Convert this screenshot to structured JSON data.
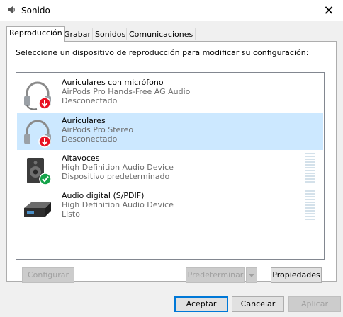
{
  "window": {
    "title": "Sonido",
    "close_glyph": "✕"
  },
  "tabs": [
    {
      "label": "Reproducción",
      "active": true
    },
    {
      "label": "Grabar",
      "active": false
    },
    {
      "label": "Sonidos",
      "active": false
    },
    {
      "label": "Comunicaciones",
      "active": false
    }
  ],
  "instruction": "Seleccione un dispositivo de reproducción para modificar su configuración:",
  "devices": [
    {
      "name": "Auriculares con micrófono",
      "model": "AirPods Pro Hands-Free AG Audio",
      "status": "Desconectado",
      "icon": "headset-disconnected-icon",
      "selected": false
    },
    {
      "name": "Auriculares",
      "model": "AirPods Pro Stereo",
      "status": "Desconectado",
      "icon": "headphones-disconnected-icon",
      "selected": true
    },
    {
      "name": "Altavoces",
      "model": "High Definition Audio Device",
      "status": "Dispositivo predeterminado",
      "icon": "speaker-default-icon",
      "selected": false
    },
    {
      "name": "Audio digital (S/PDIF)",
      "model": "High Definition Audio Device",
      "status": "Listo",
      "icon": "digital-audio-icon",
      "selected": false
    }
  ],
  "buttons": {
    "configure": "Configurar",
    "set_default": "Predeterminar",
    "properties": "Propiedades",
    "ok": "Aceptar",
    "cancel": "Cancelar",
    "apply": "Aplicar"
  },
  "colors": {
    "selection": "#cce8ff",
    "accent": "#0078d7",
    "disconnected": "#e81123",
    "default_check": "#16a34a"
  }
}
